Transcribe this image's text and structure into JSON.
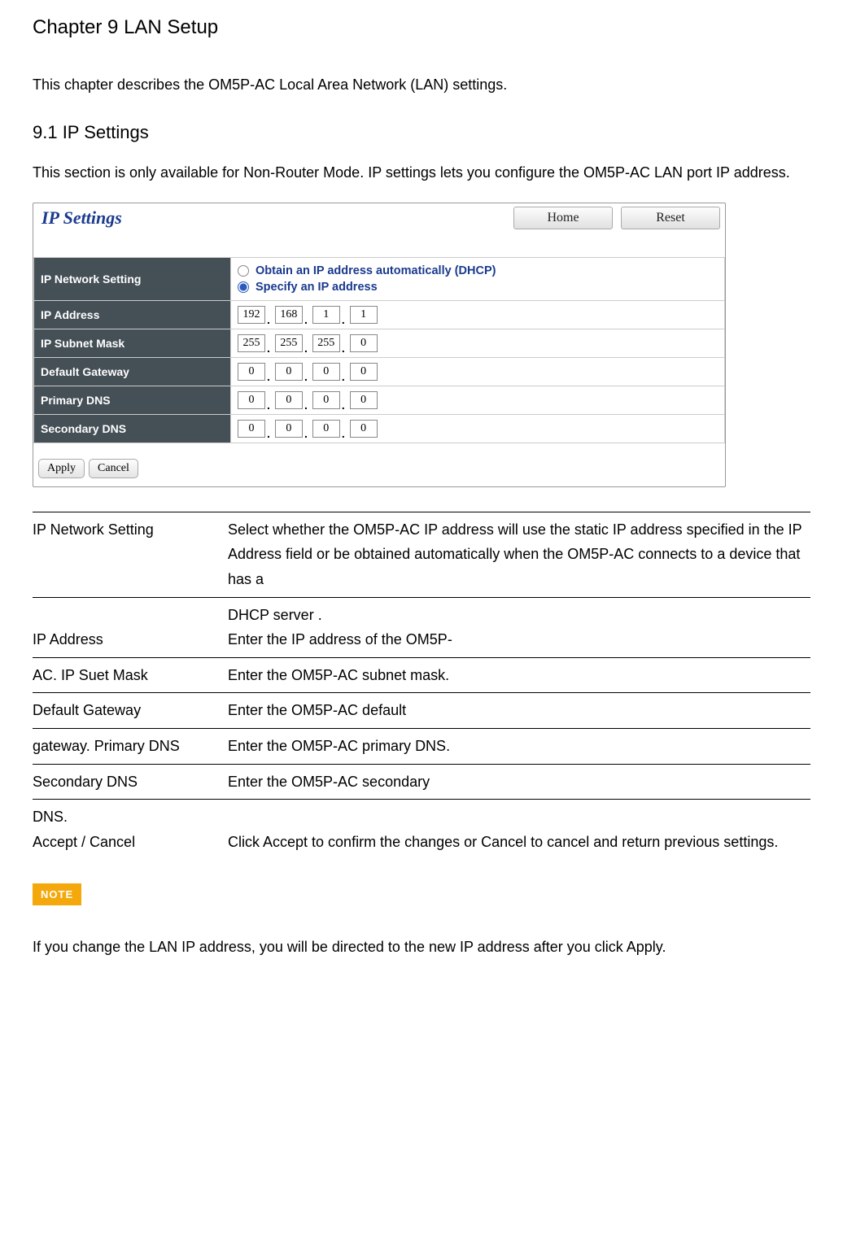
{
  "chapter_title": "Chapter 9 LAN Setup",
  "intro_text": "This chapter describes the OM5P-AC Local Area Network (LAN) settings.",
  "section_title": "9.1 IP Settings",
  "section_text": "This section is only available for Non-Router Mode. IP settings lets you configure the OM5P-AC LAN port IP address.",
  "screenshot": {
    "title": "IP Settings",
    "home_btn": "Home",
    "reset_btn": "Reset",
    "rows": {
      "network_setting": "IP Network Setting",
      "radio_dhcp": "Obtain an IP address automatically (DHCP)",
      "radio_static": "Specify an IP address",
      "ip_address": "IP Address",
      "subnet": "IP Subnet Mask",
      "gateway": "Default Gateway",
      "pdns": "Primary DNS",
      "sdns": "Secondary DNS"
    },
    "values": {
      "ip": [
        "192",
        "168",
        "1",
        "1"
      ],
      "subnet": [
        "255",
        "255",
        "255",
        "0"
      ],
      "gateway": [
        "0",
        "0",
        "0",
        "0"
      ],
      "pdns": [
        "0",
        "0",
        "0",
        "0"
      ],
      "sdns": [
        "0",
        "0",
        "0",
        "0"
      ]
    },
    "apply_btn": "Apply",
    "cancel_btn": "Cancel"
  },
  "definitions": [
    {
      "term": "IP Network Setting",
      "desc": "Select whether the OM5P-AC IP address will use the static IP address specified in the IP Address field or be obtained automatically when the OM5P-AC connects to a device that has a"
    },
    {
      "term": "IP Address",
      "desc_pre": "DHCP server .",
      "desc": "Enter the IP address of the OM5P-"
    },
    {
      "term": "AC. IP Suet Mask",
      "desc": "Enter the OM5P-AC subnet mask."
    },
    {
      "term": "Default Gateway",
      "desc": "Enter the OM5P-AC default"
    },
    {
      "term": "gateway. Primary DNS",
      "desc": "Enter the OM5P-AC primary DNS."
    },
    {
      "term": "Secondary DNS",
      "desc": "Enter the OM5P-AC secondary"
    },
    {
      "term_pre": "DNS.",
      "term": "Accept / Cancel",
      "desc": "Click Accept to confirm the changes or Cancel to cancel and return previous settings."
    }
  ],
  "note_label": "NOTE",
  "note_text": "If you change the LAN IP address, you will be directed to the new IP address after you click Apply."
}
